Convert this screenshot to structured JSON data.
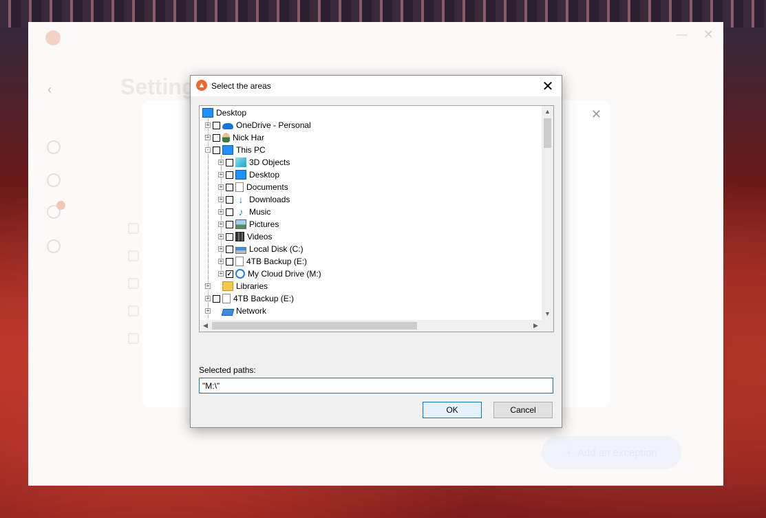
{
  "background_app": {
    "page_title": "Setting",
    "add_exception_label": "Add an exception"
  },
  "dialog": {
    "title": "Select the areas",
    "tree": [
      {
        "label": "Desktop",
        "icon": "desktop-icon",
        "level": 0,
        "expander": "none",
        "checkbox": "none"
      },
      {
        "label": "OneDrive - Personal",
        "icon": "onedrive-icon",
        "level": 1,
        "expander": "+",
        "checkbox": "unchecked"
      },
      {
        "label": "Nick Har",
        "icon": "user-icon",
        "level": 1,
        "expander": "+",
        "checkbox": "unchecked"
      },
      {
        "label": "This PC",
        "icon": "this-pc-icon",
        "level": 1,
        "expander": "-",
        "checkbox": "unchecked"
      },
      {
        "label": "3D Objects",
        "icon": "3d-objects-icon",
        "level": 2,
        "expander": "+",
        "checkbox": "unchecked"
      },
      {
        "label": "Desktop",
        "icon": "desktop-icon",
        "level": 2,
        "expander": "+",
        "checkbox": "unchecked"
      },
      {
        "label": "Documents",
        "icon": "documents-icon",
        "level": 2,
        "expander": "+",
        "checkbox": "unchecked"
      },
      {
        "label": "Downloads",
        "icon": "downloads-icon",
        "level": 2,
        "expander": "+",
        "checkbox": "unchecked"
      },
      {
        "label": "Music",
        "icon": "music-icon",
        "level": 2,
        "expander": "+",
        "checkbox": "unchecked"
      },
      {
        "label": "Pictures",
        "icon": "pictures-icon",
        "level": 2,
        "expander": "+",
        "checkbox": "unchecked"
      },
      {
        "label": "Videos",
        "icon": "videos-icon",
        "level": 2,
        "expander": "+",
        "checkbox": "unchecked"
      },
      {
        "label": "Local Disk (C:)",
        "icon": "local-disk-icon",
        "level": 2,
        "expander": "+",
        "checkbox": "unchecked"
      },
      {
        "label": "4TB Backup (E:)",
        "icon": "drive-icon",
        "level": 2,
        "expander": "+",
        "checkbox": "unchecked"
      },
      {
        "label": "My Cloud Drive (M:)",
        "icon": "cloud-drive-icon",
        "level": 2,
        "expander": "+",
        "checkbox": "checked"
      },
      {
        "label": "Libraries",
        "icon": "libraries-icon",
        "level": 1,
        "expander": "+",
        "checkbox": "none"
      },
      {
        "label": "4TB Backup (E:)",
        "icon": "drive-icon",
        "level": 1,
        "expander": "+",
        "checkbox": "unchecked"
      },
      {
        "label": "Network",
        "icon": "network-icon",
        "level": 1,
        "expander": "+",
        "checkbox": "none"
      }
    ],
    "selected_paths_label": "Selected paths:",
    "selected_paths_value": "\"M:\\\"",
    "ok_label": "OK",
    "cancel_label": "Cancel",
    "close_glyph": "✕"
  }
}
